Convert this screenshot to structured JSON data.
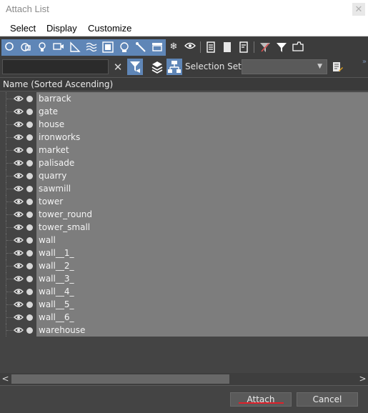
{
  "window": {
    "title": "Attach List",
    "close_glyph": "✕"
  },
  "menu": [
    {
      "label": "Select"
    },
    {
      "label": "Display"
    },
    {
      "label": "Customize"
    }
  ],
  "toolbar": {
    "icons": [
      "geometry-icon",
      "shapes-icon",
      "lights-icon",
      "cameras-icon",
      "helpers-icon",
      "space-warps-icon",
      "groups-icon",
      "xrefs-icon",
      "bones-icon",
      "containers-icon",
      "frozen-icon",
      "hidden-icon",
      "display-all-icon",
      "display-none-icon",
      "invert-display-icon",
      "filter-icon",
      "funnel-icon",
      "folder-icon"
    ],
    "accent_color": "#5f86b7"
  },
  "search": {
    "placeholder": "",
    "value": "",
    "clear_glyph": "✕"
  },
  "selection_set": {
    "label": "Selection Set:",
    "value": ""
  },
  "list": {
    "column_header": "Name (Sorted Ascending)",
    "items": [
      {
        "name": "barrack"
      },
      {
        "name": "gate"
      },
      {
        "name": "house"
      },
      {
        "name": "ironworks"
      },
      {
        "name": "market"
      },
      {
        "name": "palisade"
      },
      {
        "name": "quarry"
      },
      {
        "name": "sawmill"
      },
      {
        "name": "tower"
      },
      {
        "name": "tower_round"
      },
      {
        "name": "tower_small"
      },
      {
        "name": "wall"
      },
      {
        "name": "wall__1_"
      },
      {
        "name": "wall__2_"
      },
      {
        "name": "wall__3_"
      },
      {
        "name": "wall__4_"
      },
      {
        "name": "wall__5_"
      },
      {
        "name": "wall__6_"
      },
      {
        "name": "warehouse"
      }
    ]
  },
  "scrollbar": {
    "left_glyph": "<",
    "right_glyph": ">"
  },
  "buttons": {
    "attach_label": "Attach",
    "cancel_label": "Cancel"
  }
}
